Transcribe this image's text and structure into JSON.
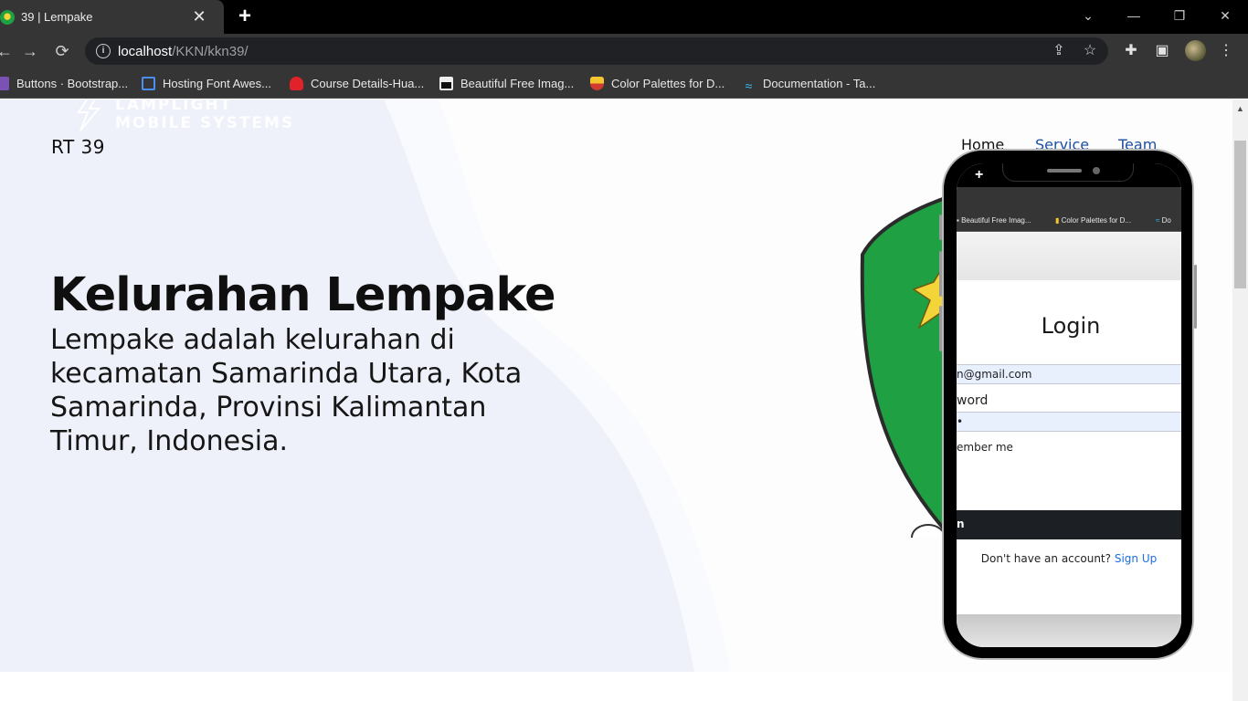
{
  "browser": {
    "tab": {
      "title": "39 | Lempake",
      "close": "✕"
    },
    "new_tab": "+",
    "window_controls": {
      "minimize": "—",
      "maximize": "❐",
      "close": "✕",
      "tab_search": "⌄"
    },
    "nav": {
      "back": "←",
      "forward": "→",
      "reload": "⟳"
    },
    "url": {
      "host": "localhost",
      "path": "/KKN/kkn39/"
    },
    "icons": [
      "info-icon",
      "share-icon",
      "star-icon",
      "extensions-icon",
      "side-panel-icon",
      "avatar",
      "menu-icon"
    ],
    "bookmarks": [
      {
        "label": "Buttons · Bootstrap...",
        "icon": "bootstrap-icon",
        "color": "#7952b3"
      },
      {
        "label": "Hosting Font Awes...",
        "icon": "flag-icon",
        "color": "#4a8ff3"
      },
      {
        "label": "Course Details-Hua...",
        "icon": "huawei-icon",
        "color": "#e0222a"
      },
      {
        "label": "Beautiful Free Imag...",
        "icon": "unsplash-icon",
        "color": "#ffffff"
      },
      {
        "label": "Color Palettes for D...",
        "icon": "palette-icon",
        "color": "#f3c530"
      },
      {
        "label": "Documentation - Ta...",
        "icon": "tailwind-icon",
        "color": "#38bdf8"
      }
    ]
  },
  "page": {
    "watermark": {
      "line1": "LAMPLIGHT",
      "line2": "MOBILE SYSTEMS"
    },
    "brand": "RT 39",
    "nav": [
      {
        "label": "Home",
        "color": "#111111"
      },
      {
        "label": "Service",
        "color": "#1d4fa3"
      },
      {
        "label": "Team",
        "color": "#1d4fa3"
      }
    ],
    "hero": {
      "title": "Kelurahan Lempake",
      "description": "Lempake adalah kelurahan di kecamatan Samarinda Utara, Kota Samarinda, Provinsi Kalimantan Timur, Indonesia."
    },
    "phone": {
      "plus": "+",
      "bookmarks": [
        "Beautiful Free Imag...",
        "Color Palettes for D...",
        "Do"
      ],
      "login_title": "Login",
      "email_value": "n@gmail.com",
      "password_label": "word",
      "password_value": "•",
      "remember": "ember me",
      "login_button": "n",
      "signup_prompt": "Don't have an account?",
      "signup_link": "Sign Up"
    }
  },
  "colors": {
    "accent": "#1d4fa3",
    "hero_bg": "#eef1f9",
    "link": "#1a6fe0"
  }
}
